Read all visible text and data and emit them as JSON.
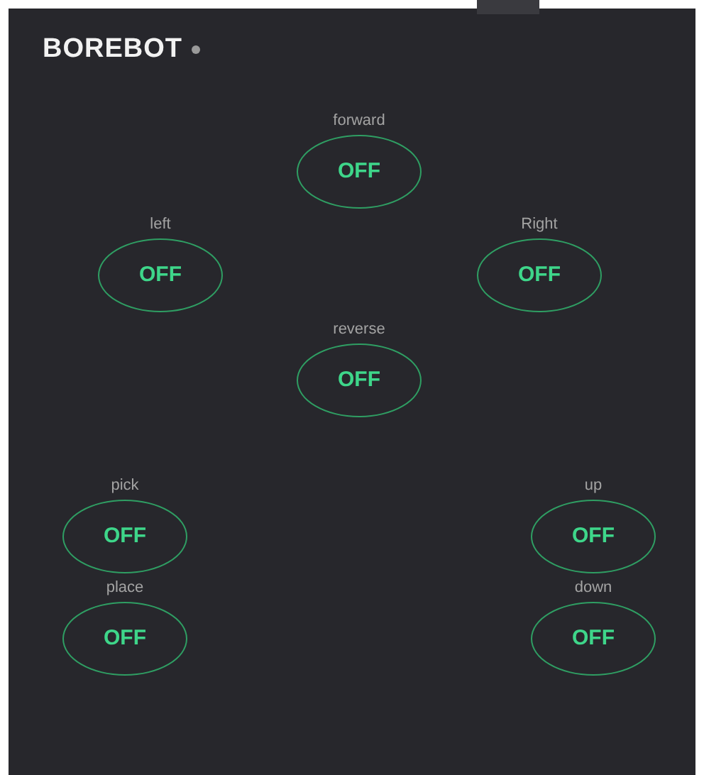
{
  "app": {
    "title": "BOREBOT"
  },
  "controls": [
    {
      "label": "forward",
      "state_text": "OFF",
      "on": false
    },
    {
      "label": "left",
      "state_text": "OFF",
      "on": false
    },
    {
      "label": "Right",
      "state_text": "OFF",
      "on": false
    },
    {
      "label": "reverse",
      "state_text": "OFF",
      "on": false
    },
    {
      "label": "pick",
      "state_text": "OFF",
      "on": false
    },
    {
      "label": "up",
      "state_text": "OFF",
      "on": false
    },
    {
      "label": "place",
      "state_text": "OFF",
      "on": false
    },
    {
      "label": "down",
      "state_text": "OFF",
      "on": false
    }
  ]
}
